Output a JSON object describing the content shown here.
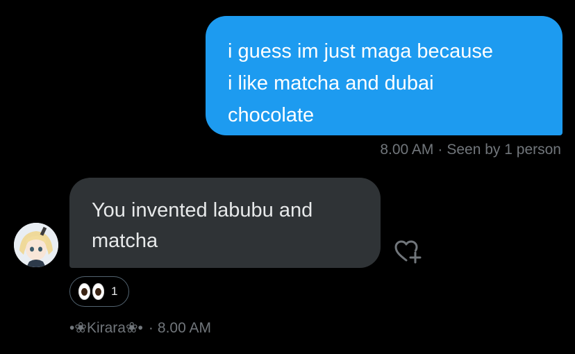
{
  "sent_message": {
    "lines": [
      "i guess im just maga because",
      "i like matcha and dubai",
      "chocolate"
    ],
    "time": "8.00 AM",
    "status": "Seen by 1 person"
  },
  "received_message": {
    "lines": [
      "You invented labubu and",
      "matcha"
    ],
    "sender": "•❀Kirara❀•",
    "time": "8.00 AM",
    "reaction": {
      "emoji_icon": "eyes-emoji-icon",
      "count": "1"
    }
  },
  "colors": {
    "background": "#000000",
    "sent_bubble": "#1d9bf0",
    "received_bubble": "#2f3336",
    "meta_text": "#71767b"
  }
}
